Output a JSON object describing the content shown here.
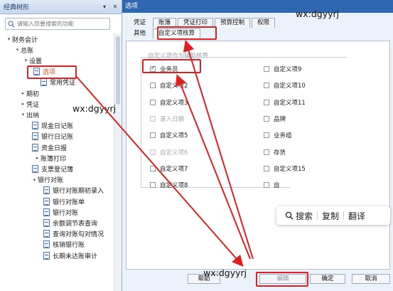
{
  "left_panel": {
    "title": "经典树形",
    "pin_icon": "pin-icon",
    "close_icon": "close-icon",
    "search_placeholder": "请输入您要搜索的功能",
    "tree": [
      {
        "label": "财务会计",
        "caret": "▾",
        "icon": false
      },
      {
        "label": "总账",
        "caret": "▾",
        "icon": false
      },
      {
        "label": "设置",
        "caret": "▾",
        "icon": false
      },
      {
        "label": "选项",
        "caret": "",
        "icon": true,
        "selected": true
      },
      {
        "label": "常用凭证",
        "caret": "",
        "icon": true
      },
      {
        "label": "期初",
        "caret": "▸",
        "icon": false
      },
      {
        "label": "凭证",
        "caret": "▸",
        "icon": false
      },
      {
        "label": "出纳",
        "caret": "▾",
        "icon": false
      },
      {
        "label": "现金日记账",
        "caret": "",
        "icon": true
      },
      {
        "label": "银行日记账",
        "caret": "",
        "icon": true
      },
      {
        "label": "资金日报",
        "caret": "",
        "icon": true
      },
      {
        "label": "账簿打印",
        "caret": "▸",
        "icon": false
      },
      {
        "label": "支票登记簿",
        "caret": "",
        "icon": true
      },
      {
        "label": "银行对账",
        "caret": "▾",
        "icon": false
      },
      {
        "label": "银行对账期初录入",
        "caret": "",
        "icon": true
      },
      {
        "label": "银行对账单",
        "caret": "",
        "icon": true
      },
      {
        "label": "银行对账",
        "caret": "",
        "icon": true
      },
      {
        "label": "余额调节表查询",
        "caret": "",
        "icon": true
      },
      {
        "label": "查询对账勾对情况",
        "caret": "",
        "icon": true
      },
      {
        "label": "核销银行账",
        "caret": "",
        "icon": true
      },
      {
        "label": "长期未达账审计",
        "caret": "",
        "icon": true
      }
    ]
  },
  "dialog": {
    "title": "选项",
    "tabs_row1": [
      "凭证",
      "账簿",
      "凭证打印",
      "预算控制",
      "权限"
    ],
    "tabs_row2": [
      "其他",
      "自定义项核算"
    ],
    "active_tab": "自定义项核算",
    "group_title": "自定义项作为辅助核算",
    "options_left": [
      {
        "label": "业务员",
        "checked": true,
        "disabled": false
      },
      {
        "label": "自定义项2",
        "checked": false,
        "disabled": false
      },
      {
        "label": "自定义项3",
        "checked": false,
        "disabled": false
      },
      {
        "label": "录入日期",
        "checked": false,
        "disabled": true
      },
      {
        "label": "自定义项5",
        "checked": false,
        "disabled": false
      },
      {
        "label": "自定义项6",
        "checked": false,
        "disabled": true
      },
      {
        "label": "自定义项7",
        "checked": false,
        "disabled": false
      },
      {
        "label": "自定义项8",
        "checked": false,
        "disabled": false
      }
    ],
    "options_right": [
      {
        "label": "自定义项9",
        "checked": false,
        "disabled": false
      },
      {
        "label": "自定义项10",
        "checked": false,
        "disabled": false
      },
      {
        "label": "自定义项11",
        "checked": false,
        "disabled": false
      },
      {
        "label": "品牌",
        "checked": false,
        "disabled": false
      },
      {
        "label": "业务组",
        "checked": false,
        "disabled": false
      },
      {
        "label": "存货",
        "checked": false,
        "disabled": false
      },
      {
        "label": "自定义项15",
        "checked": false,
        "disabled": false
      },
      {
        "label": "自",
        "checked": false,
        "disabled": false
      }
    ],
    "context_menu": {
      "search": "搜索",
      "copy": "复制",
      "translate": "翻译"
    },
    "buttons": {
      "help": "帮助",
      "edit": "编辑",
      "ok": "确定",
      "cancel": "取消"
    }
  },
  "watermarks": [
    "wx:dgyyrj",
    "wx:dgyyrj",
    "wx:dgyyrj"
  ],
  "annotation_color": "#e02020"
}
